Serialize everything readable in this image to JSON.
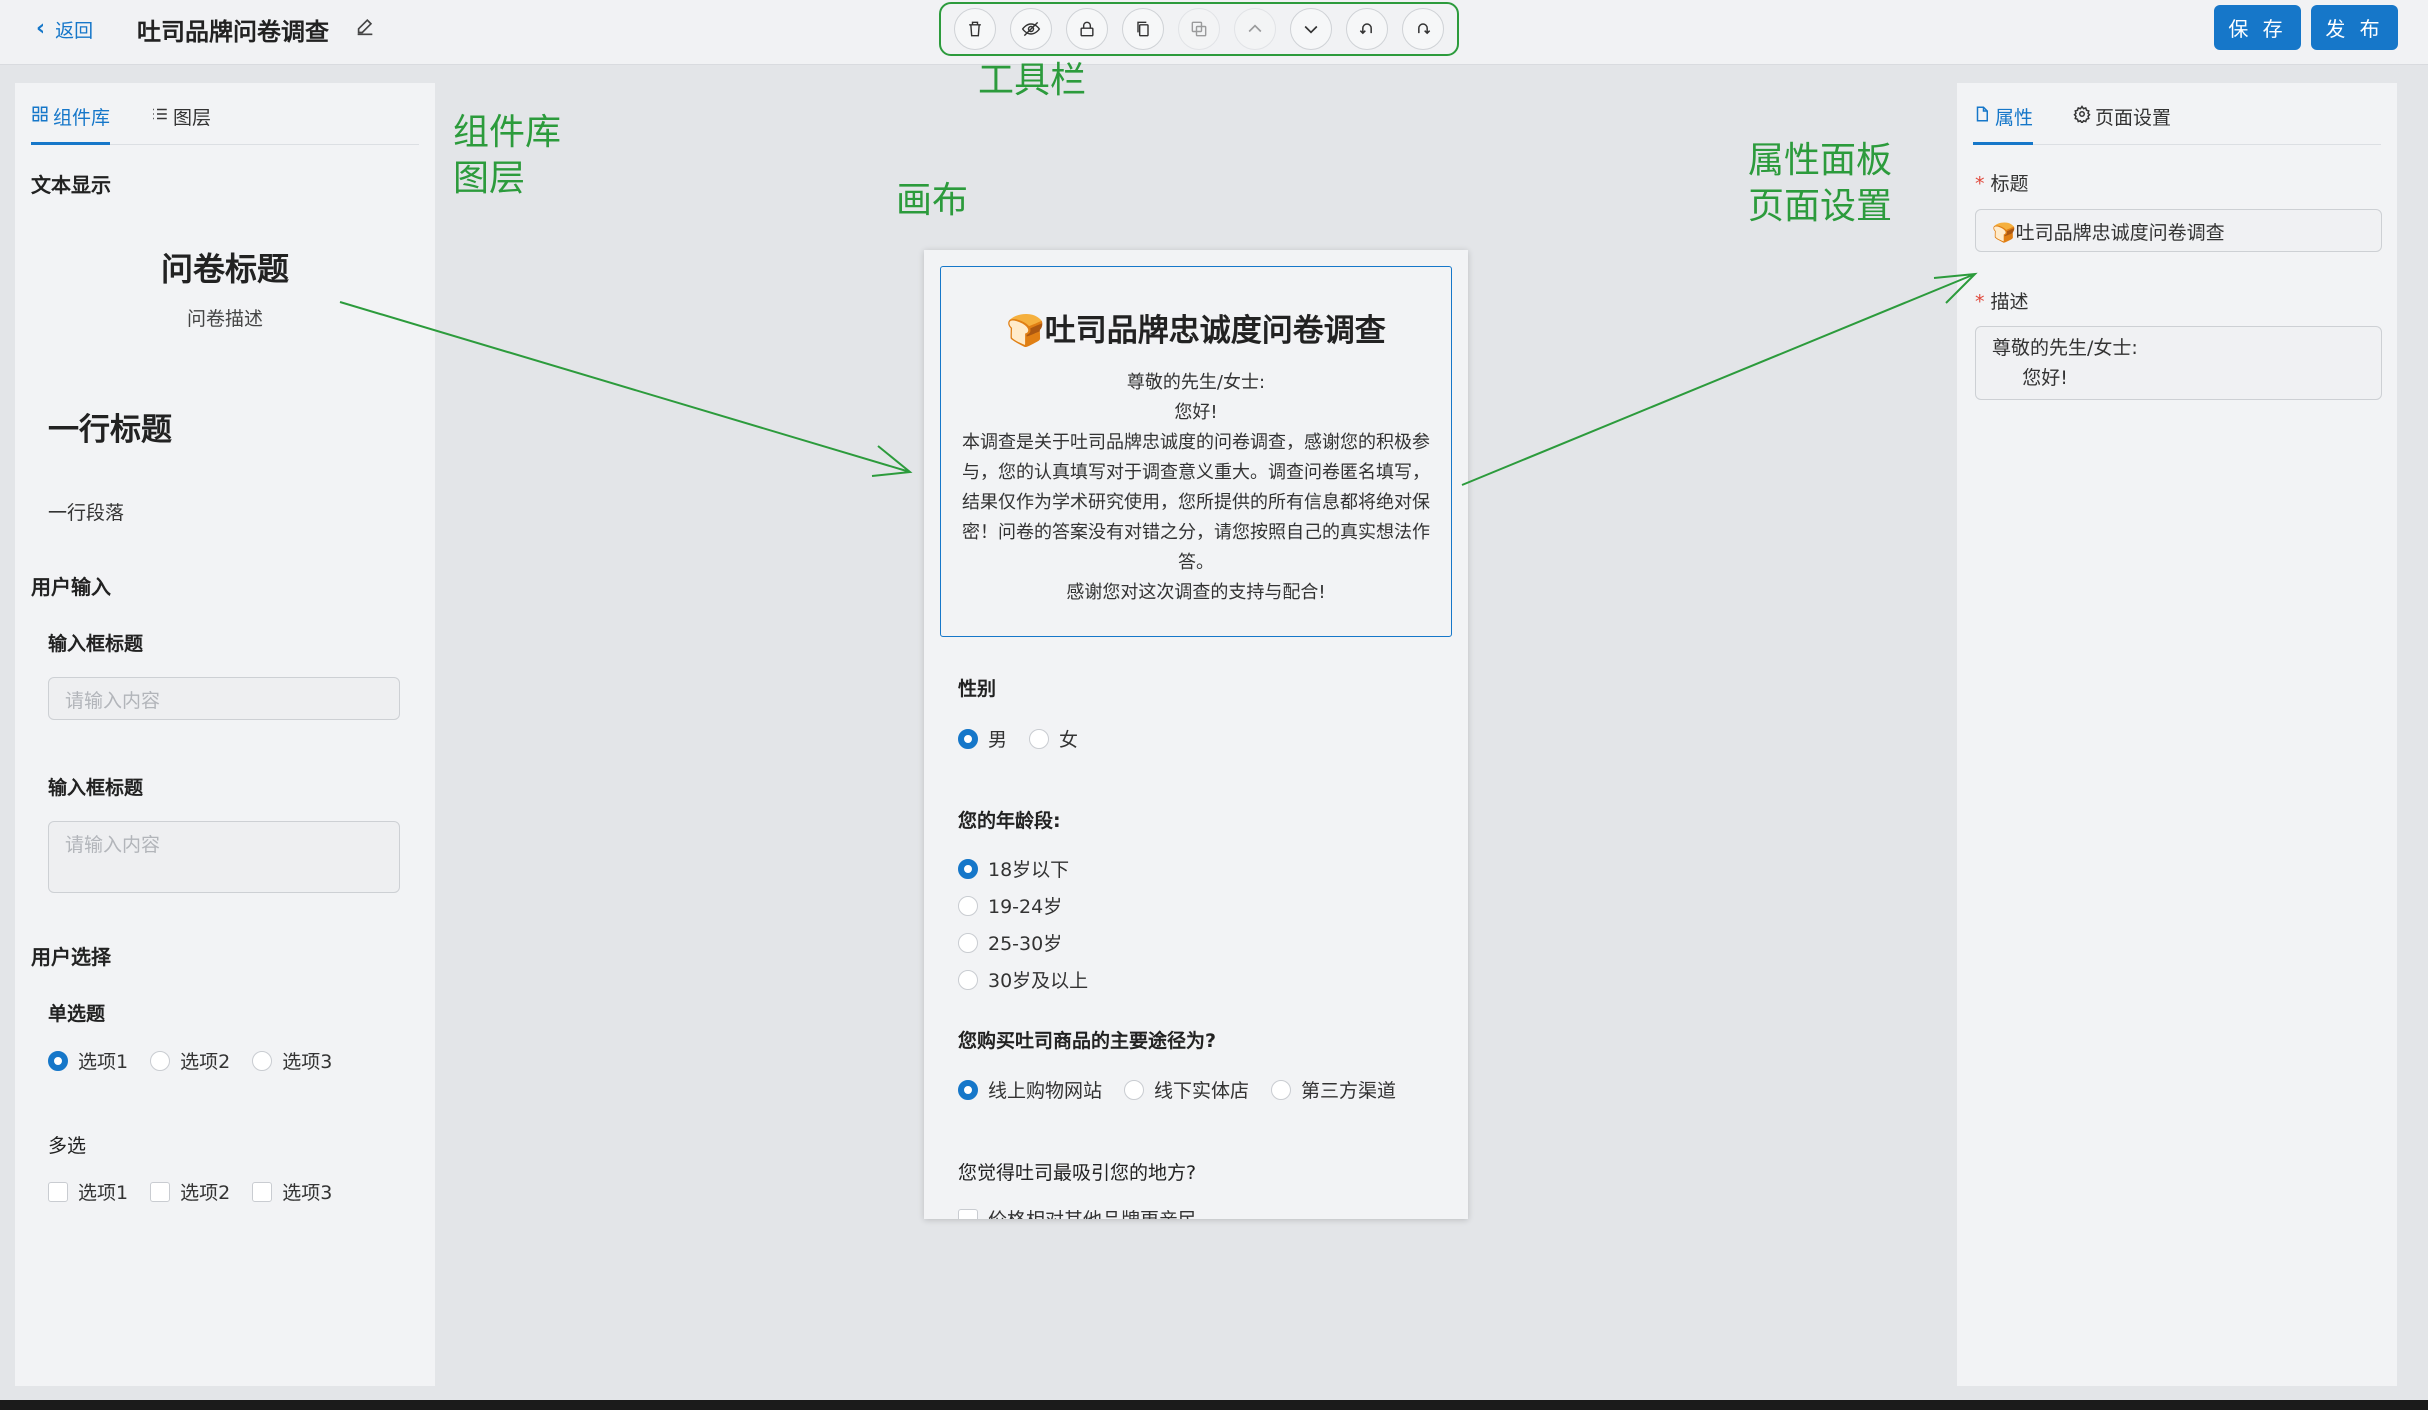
{
  "header": {
    "back_label": "返回",
    "survey_name": "吐司品牌问卷调查",
    "save_label": "保 存",
    "publish_label": "发 布"
  },
  "toolbar": {
    "buttons": [
      {
        "icon": "delete-icon",
        "enabled": true
      },
      {
        "icon": "hide-icon",
        "enabled": true
      },
      {
        "icon": "lock-icon",
        "enabled": true
      },
      {
        "icon": "copy-icon",
        "enabled": true
      },
      {
        "icon": "paste-icon",
        "enabled": false
      },
      {
        "icon": "move-up-icon",
        "enabled": false
      },
      {
        "icon": "move-down-icon",
        "enabled": true
      },
      {
        "icon": "undo-icon",
        "enabled": true
      },
      {
        "icon": "redo-icon",
        "enabled": true
      }
    ]
  },
  "annotations": {
    "toolbar": "工具栏",
    "library": "组件库\n图层",
    "canvas": "画布",
    "properties": "属性面板\n页面设置"
  },
  "left_panel": {
    "tabs": [
      "组件库",
      "图层"
    ],
    "active_tab": 0,
    "sections": {
      "text_display": "文本显示",
      "user_input": "用户输入",
      "user_select": "用户选择"
    },
    "components": {
      "q_title": "问卷标题",
      "q_desc": "问卷描述",
      "line_title": "一行标题",
      "line_para": "一行段落",
      "input_label_1": "输入框标题",
      "input_placeholder_1": "请输入内容",
      "input_label_2": "输入框标题",
      "input_placeholder_2": "请输入内容",
      "radio_label": "单选题",
      "radio_options": [
        "选项1",
        "选项2",
        "选项3"
      ],
      "check_label": "多选",
      "check_options": [
        "选项1",
        "选项2",
        "选项3"
      ]
    }
  },
  "canvas": {
    "intro_title": "🍞吐司品牌忠诚度问卷调查",
    "intro_desc": "尊敬的先生/女士:\n您好!\n本调查是关于吐司品牌忠诚度的问卷调查，感谢您的积极参与，您的认真填写对于调查意义重大。调查问卷匿名填写，结果仅作为学术研究使用，您所提供的所有信息都将绝对保密！问卷的答案没有对错之分，请您按照自己的真实想法作答。\n感谢您对这次调查的支持与配合!",
    "q1": {
      "title": "性别",
      "options": [
        "男",
        "女"
      ]
    },
    "q2": {
      "title": "您的年龄段:",
      "options": [
        "18岁以下",
        "19-24岁",
        "25-30岁",
        "30岁及以上"
      ]
    },
    "q3": {
      "title": "您购买吐司商品的主要途径为?",
      "options": [
        "线上购物网站",
        "线下实体店",
        "第三方渠道"
      ]
    },
    "q4": {
      "title": "您觉得吐司最吸引您的地方?",
      "first_option": "价格相对其他品牌更亲民"
    }
  },
  "right_panel": {
    "tabs": [
      "属性",
      "页面设置"
    ],
    "active_tab": 0,
    "title_label": "标题",
    "title_value": "🍞吐司品牌忠诚度问卷调查",
    "desc_label": "描述",
    "desc_value": "尊敬的先生/女士:\n     您好!"
  },
  "colors": {
    "accent": "#1677c9",
    "annotation": "#2c9b3c",
    "required": "#e0493c"
  }
}
